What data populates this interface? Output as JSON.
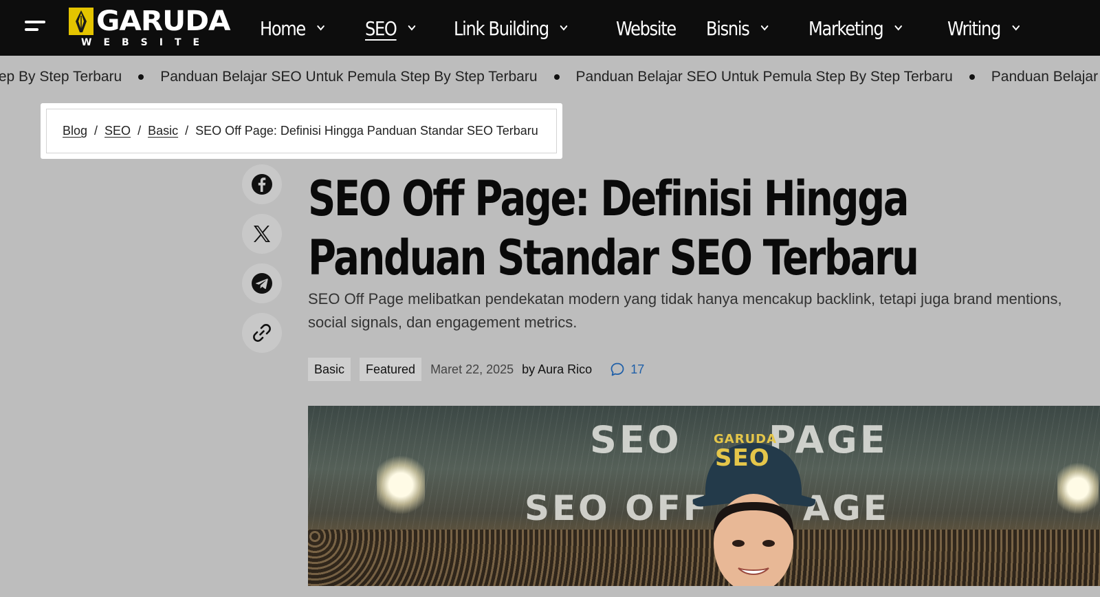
{
  "header": {
    "logo": {
      "word": "GARUDA",
      "sub": "WEBSITE"
    },
    "nav": [
      {
        "label": "Home",
        "has_dropdown": true,
        "active": false
      },
      {
        "label": "SEO",
        "has_dropdown": true,
        "active": true
      },
      {
        "label": "Link Building",
        "has_dropdown": true,
        "active": false
      },
      {
        "label": "Website",
        "has_dropdown": false,
        "active": false
      },
      {
        "label": "Bisnis",
        "has_dropdown": true,
        "active": false
      },
      {
        "label": "Marketing",
        "has_dropdown": true,
        "active": false
      },
      {
        "label": "Writing",
        "has_dropdown": true,
        "active": false
      }
    ]
  },
  "ticker": {
    "items": [
      "tep By Step Terbaru",
      "Panduan Belajar SEO Untuk Pemula Step By Step Terbaru",
      "Panduan Belajar SEO Untuk Pemula Step By Step Terbaru",
      "Panduan Belajar SE"
    ]
  },
  "breadcrumb": {
    "items": [
      "Blog",
      "SEO",
      "Basic"
    ],
    "current": "SEO Off Page: Definisi Hingga Panduan Standar SEO Terbaru",
    "separator": "/"
  },
  "share": {
    "icons": [
      "facebook-icon",
      "x-icon",
      "telegram-icon",
      "link-icon"
    ]
  },
  "article": {
    "title": "SEO Off Page: Definisi Hingga Panduan Standar SEO Terbaru",
    "lede": "SEO Off Page melibatkan pendekatan modern yang tidak hanya mencakup backlink, tetapi juga brand mentions, social signals, dan engagement metrics.",
    "tags": [
      "Basic",
      "Featured"
    ],
    "date": "Maret 22, 2025",
    "author": "by Aura Rico",
    "comment_count": "17",
    "hero_text": {
      "line1_left": "SEO",
      "line1_right": "PAGE",
      "line2_left": "SEO OFF",
      "line2_right": "AGE",
      "cap_top": "GARUDA",
      "cap_main": "SEO"
    }
  },
  "colors": {
    "topbar": "#0d0d0d",
    "page_bg": "#bdbdbd",
    "logo_accent": "#e4c400",
    "comment_link": "#1f5fa8"
  }
}
